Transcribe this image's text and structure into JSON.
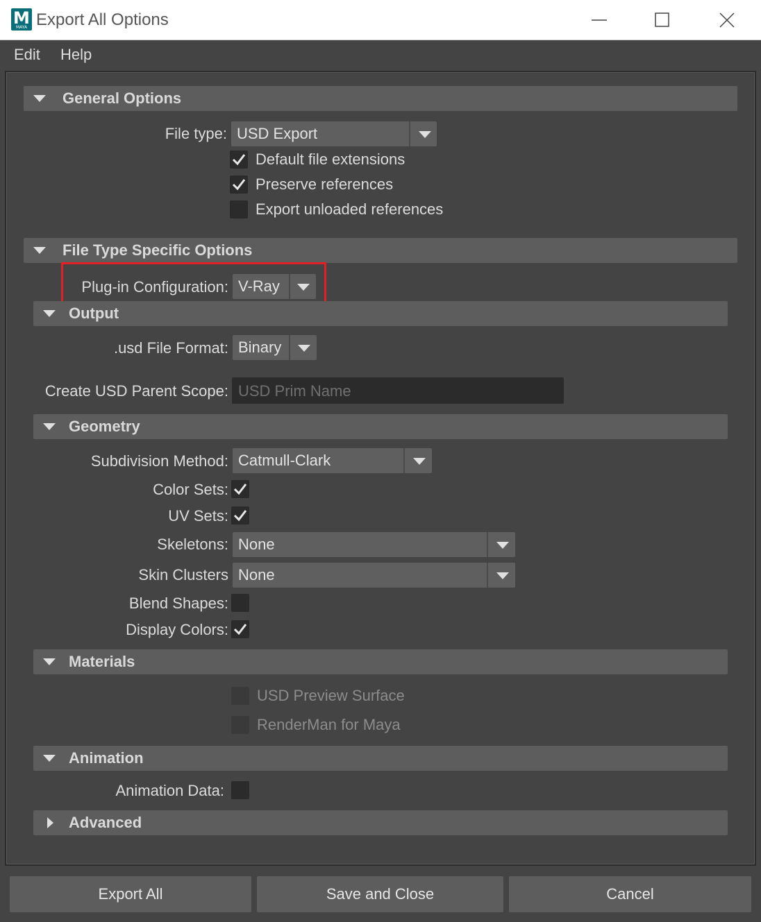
{
  "window": {
    "title": "Export All Options",
    "logo_letter": "M",
    "logo_sub": "MAYA",
    "minimize_icon": "minimize-icon",
    "maximize_icon": "maximize-icon",
    "close_icon": "close-icon"
  },
  "menu": {
    "items": [
      "Edit",
      "Help"
    ]
  },
  "general": {
    "title": "General Options",
    "file_type_label": "File type:",
    "file_type_value": "USD Export",
    "default_ext_label": "Default file extensions",
    "default_ext_checked": true,
    "preserve_refs_label": "Preserve references",
    "preserve_refs_checked": true,
    "export_unloaded_label": "Export unloaded references",
    "export_unloaded_checked": false
  },
  "file_type_specific": {
    "title": "File Type Specific Options",
    "plugin_config_label": "Plug-in Configuration:",
    "plugin_config_value": "V-Ray"
  },
  "output": {
    "title": "Output",
    "usd_format_label": ".usd File Format:",
    "usd_format_value": "Binary",
    "parent_scope_label": "Create USD Parent Scope:",
    "parent_scope_placeholder": "USD Prim Name"
  },
  "geometry": {
    "title": "Geometry",
    "subdivision_label": "Subdivision Method:",
    "subdivision_value": "Catmull-Clark",
    "color_sets_label": "Color Sets:",
    "color_sets_checked": true,
    "uv_sets_label": "UV Sets:",
    "uv_sets_checked": true,
    "skeletons_label": "Skeletons:",
    "skeletons_value": "None",
    "skin_clusters_label": "Skin Clusters",
    "skin_clusters_value": "None",
    "blend_shapes_label": "Blend Shapes:",
    "blend_shapes_checked": false,
    "display_colors_label": "Display Colors:",
    "display_colors_checked": true
  },
  "materials": {
    "title": "Materials",
    "usd_preview_label": "USD Preview Surface",
    "renderman_label": "RenderMan for Maya"
  },
  "animation": {
    "title": "Animation",
    "anim_data_label": "Animation Data:",
    "anim_data_checked": false
  },
  "advanced": {
    "title": "Advanced"
  },
  "buttons": {
    "export_all": "Export All",
    "save_close": "Save and Close",
    "cancel": "Cancel"
  },
  "colors": {
    "highlight": "#e41f26",
    "background": "#444444",
    "section": "#5d5d5d"
  }
}
